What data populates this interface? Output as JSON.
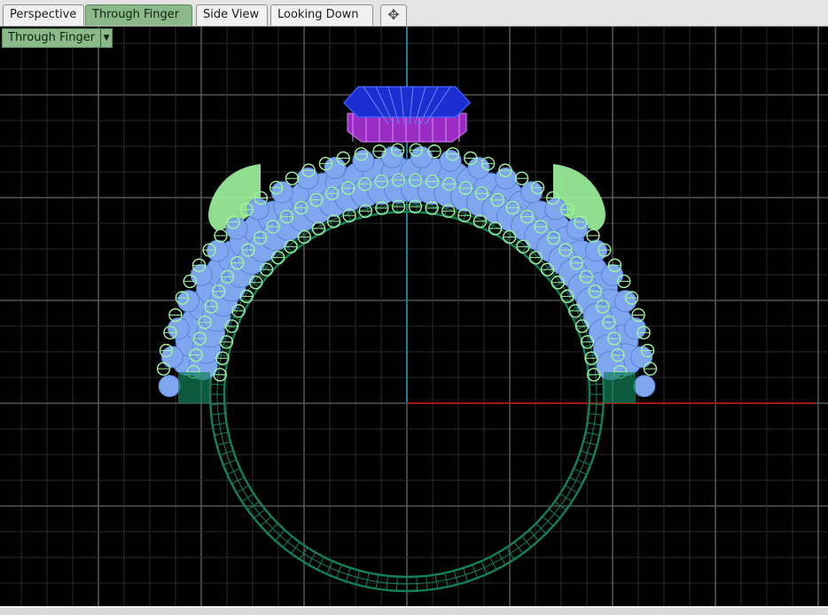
{
  "tabs": [
    {
      "label": "Perspective",
      "active": false
    },
    {
      "label": "Through Finger",
      "active": true
    },
    {
      "label": "Side View",
      "active": false
    },
    {
      "label": "Looking Down",
      "active": false
    }
  ],
  "add_tab_icon": "plus-icon",
  "viewport": {
    "label": "Through Finger",
    "dropdown_icon": "triangle-down-icon"
  },
  "colors": {
    "grid_minor": "#2b2b2b",
    "grid_major": "#565656",
    "x_axis": "#a01818",
    "y_axis": "#1f7c9a",
    "shank": "#12805a",
    "pave_stones": "#7fa6ef",
    "pave_prongs": "#9ef59e",
    "center_stone": "#1a2ed2",
    "center_setting": "#9a2cc4",
    "active_tab": "#8bb98b"
  }
}
